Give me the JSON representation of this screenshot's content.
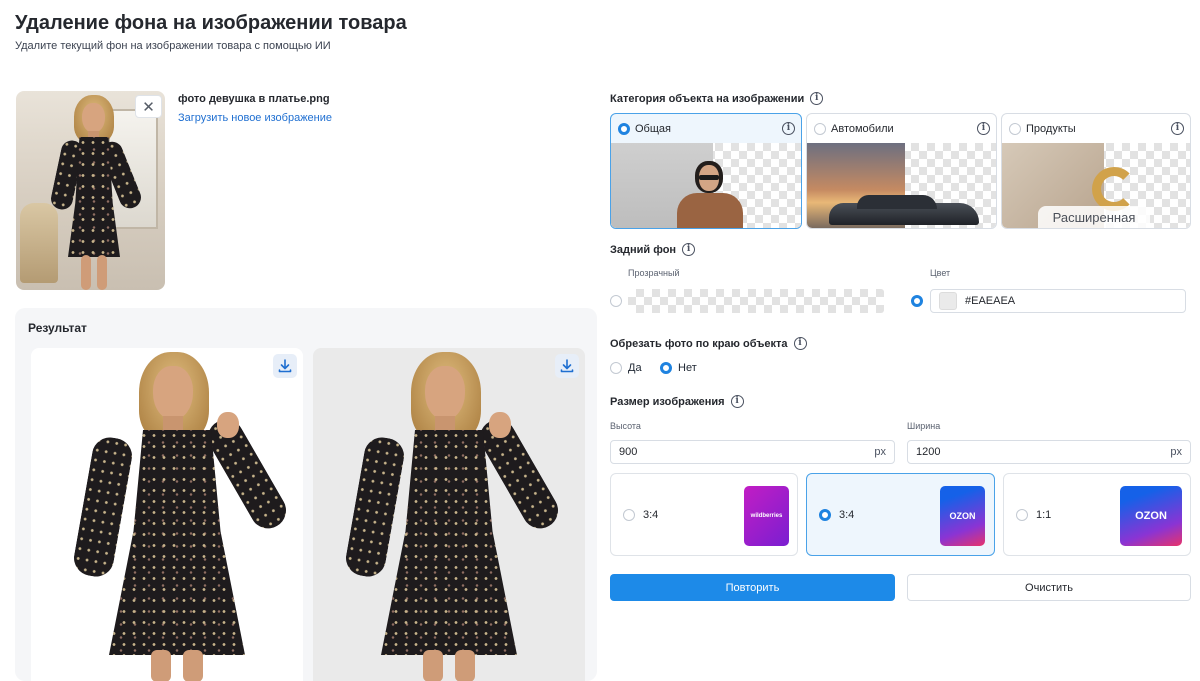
{
  "header": {
    "title": "Удаление фона на изображении товара",
    "subtitle": "Удалите текущий фон на изображении товара с помощью ИИ"
  },
  "upload": {
    "file_name": "фото девушка в платье.png",
    "upload_link": "Загрузить новое изображение",
    "remove_icon": "close-icon"
  },
  "result": {
    "title": "Результат",
    "download_icon": "download-icon"
  },
  "category": {
    "label": "Категория объекта на изображении",
    "options": [
      {
        "label": "Общая",
        "selected": true
      },
      {
        "label": "Автомобили",
        "selected": false
      },
      {
        "label": "Продукты",
        "selected": false
      }
    ],
    "badge": "Расширенная"
  },
  "background": {
    "label": "Задний фон",
    "transparent_label": "Прозрачный",
    "color_label": "Цвет",
    "color_value": "#EAEAEA",
    "selected": "color"
  },
  "crop": {
    "label": "Обрезать фото по краю объекта",
    "options": [
      {
        "label": "Да",
        "selected": false
      },
      {
        "label": "Нет",
        "selected": true
      }
    ]
  },
  "size": {
    "label": "Размер изображения",
    "height_label": "Высота",
    "height_value": "900",
    "width_label": "Ширина",
    "width_value": "1200",
    "unit": "px",
    "presets": [
      {
        "ratio": "3:4",
        "brand": "wildberries",
        "selected": false
      },
      {
        "ratio": "3:4",
        "brand": "OZON",
        "selected": true
      },
      {
        "ratio": "1:1",
        "brand": "OZON",
        "selected": false
      }
    ]
  },
  "actions": {
    "repeat": "Повторить",
    "clear": "Очистить"
  },
  "colors": {
    "primary": "#1D8AE8",
    "link": "#1F6FD1",
    "selected_border": "#4AA2E8",
    "selected_bg": "#EEF6FD",
    "result_bg": "#EAEAEA"
  }
}
